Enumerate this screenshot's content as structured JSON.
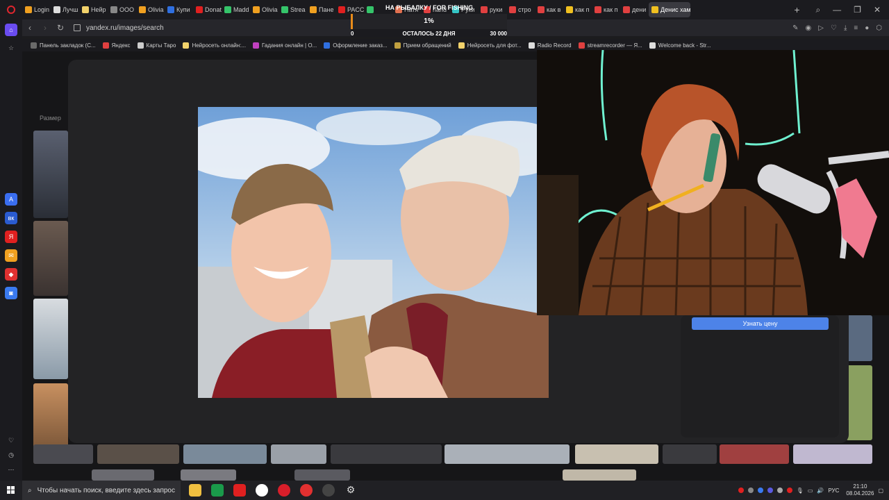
{
  "tabs": [
    {
      "label": "Login",
      "color": "#f0a020"
    },
    {
      "label": "Лучш",
      "color": "#dddddd"
    },
    {
      "label": "Нейр",
      "color": "#f2d26b"
    },
    {
      "label": "ООО",
      "color": "#888888"
    },
    {
      "label": "Olivia",
      "color": "#f0a020"
    },
    {
      "label": "Купи",
      "color": "#2f6fe0"
    },
    {
      "label": "Donat",
      "color": "#e02020"
    },
    {
      "label": "Madd",
      "color": "#35c46a"
    },
    {
      "label": "Olivia",
      "color": "#f0a020"
    },
    {
      "label": "Strea",
      "color": "#35c46a"
    },
    {
      "label": "Пане",
      "color": "#f0a020"
    },
    {
      "label": "PACC",
      "color": "#e02020"
    },
    {
      "label": "",
      "color": "#35c46a"
    },
    {
      "label": "Натя",
      "color": "#e07050"
    },
    {
      "label": "hand",
      "color": "#e04040"
    },
    {
      "label": "Руки",
      "color": "#35c4c4"
    },
    {
      "label": "руки",
      "color": "#e04040"
    },
    {
      "label": "стро",
      "color": "#e04040"
    },
    {
      "label": "как в",
      "color": "#e04040"
    },
    {
      "label": "как п",
      "color": "#f0c020"
    },
    {
      "label": "как п",
      "color": "#e04040"
    },
    {
      "label": "дени",
      "color": "#e04040"
    },
    {
      "label": "Денис хам",
      "color": "#f0c020",
      "active": true
    }
  ],
  "address": {
    "url": "yandex.ru/images/search"
  },
  "stream_overlay": {
    "percent": "1%",
    "goal_title": "НА РЫБАЛКУ / FOR FISHING",
    "start_value": "0",
    "days_left": "ОСТАЛОСЬ 22 ДНЯ",
    "target_value": "30 000",
    "progress_fraction": 0.01
  },
  "bookmarks": [
    {
      "label": "Панель закладок (С...",
      "color": "#6a6a6a"
    },
    {
      "label": "Яндекс",
      "color": "#e04040"
    },
    {
      "label": "Карты Таро",
      "color": "#cccccc"
    },
    {
      "label": "Нейросеть онлайн:...",
      "color": "#f2d26b"
    },
    {
      "label": "Гадания онлайн | О...",
      "color": "#c040c0"
    },
    {
      "label": "Оформление заказ...",
      "color": "#2f6fe0"
    },
    {
      "label": "Прием обращений",
      "color": "#c0a040"
    },
    {
      "label": "Нейросеть для фот...",
      "color": "#f2d26b"
    },
    {
      "label": "Radio Record",
      "color": "#dddddd"
    },
    {
      "label": "streamrecorder — Я...",
      "color": "#e04040"
    },
    {
      "label": "Welcome back - Str...",
      "color": "#dddddd"
    }
  ],
  "page": {
    "filter_label": "Размер",
    "price_button": "Узнать цену"
  },
  "taskbar": {
    "search_placeholder": "Чтобы начать поиск, введите здесь запрос",
    "language": "РУС",
    "time": "21:10",
    "date": "08.04.2026"
  }
}
